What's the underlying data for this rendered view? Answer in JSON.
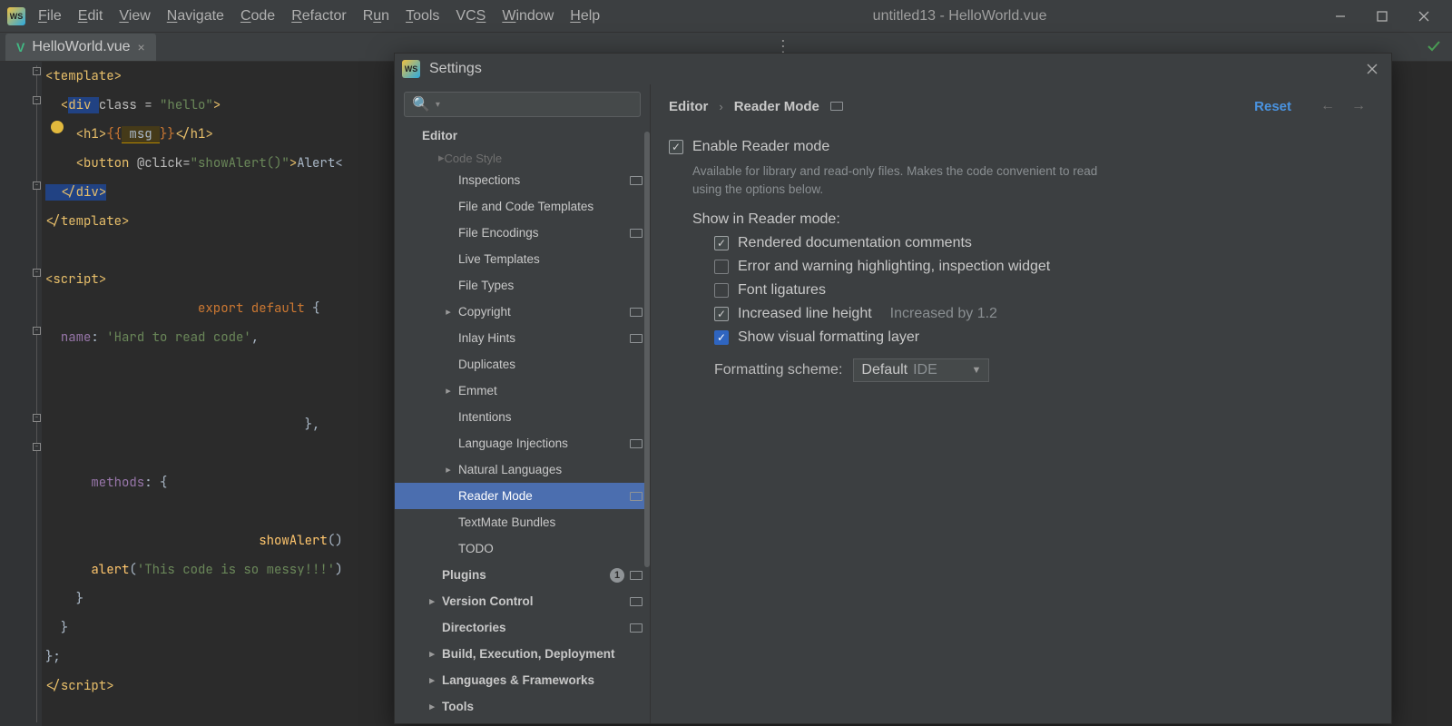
{
  "window": {
    "title": "untitled13 - HelloWorld.vue",
    "menus": [
      "File",
      "Edit",
      "View",
      "Navigate",
      "Code",
      "Refactor",
      "Run",
      "Tools",
      "VCS",
      "Window",
      "Help"
    ]
  },
  "tab": {
    "filename": "HelloWorld.vue"
  },
  "code": {
    "l1a": "<",
    "l1b": "template",
    "l1c": ">",
    "l2a": "  <",
    "l2b": "div ",
    "l2c": "class = ",
    "l2d": "\"hello\"",
    "l2e": ">",
    "l3a": "    <",
    "l3b": "h1",
    "l3c": ">",
    "l3d": "{{",
    "l3e": " msg ",
    "l3f": "}}",
    "l3g": "</",
    "l3h": "h1",
    "l3i": ">",
    "l4a": "    <",
    "l4b": "button ",
    "l4c": "@click=",
    "l4d": "\"showAlert()\"",
    "l4e": ">",
    "l4f": "Alert<",
    "l5a": "  </",
    "l5b": "div",
    "l5c": ">",
    "l6a": "</",
    "l6b": "template",
    "l6c": ">",
    "l7": "",
    "l8a": "<",
    "l8b": "script",
    "l8c": ">",
    "l9a": "                    ",
    "l9b": "export default ",
    "l9c": "{",
    "l10a": "  ",
    "l10b": "name",
    "l10c": ": ",
    "l10d": "'Hard to read code'",
    "l10e": ",",
    "l11": "",
    "l12": "",
    "l13a": "                                  ",
    "l13b": "}",
    "l13c": ",",
    "l14": "",
    "l15a": "      ",
    "l15b": "methods",
    "l15c": ": {",
    "l16": "",
    "l17a": "                            ",
    "l17b": "showAlert",
    "l17c": "()",
    "l18a": "      ",
    "l18b": "alert",
    "l18c": "(",
    "l18d": "'This code is so messy!!!'",
    "l18e": ")",
    "l19": "    }",
    "l20": "  }",
    "l21a": "}",
    "l21b": ";",
    "l22a": "</",
    "l22b": "script",
    "l22c": ">"
  },
  "settings": {
    "title": "Settings",
    "search_placeholder": "",
    "crumbs": {
      "root": "Editor",
      "leaf": "Reader Mode"
    },
    "reset": "Reset",
    "tree": {
      "faded": "Code Style",
      "editor": "Editor",
      "items": [
        {
          "label": "Inspections",
          "badge": true
        },
        {
          "label": "File and Code Templates"
        },
        {
          "label": "File Encodings",
          "badge": true
        },
        {
          "label": "Live Templates"
        },
        {
          "label": "File Types"
        },
        {
          "label": "Copyright",
          "chev": true,
          "badge": true
        },
        {
          "label": "Inlay Hints",
          "badge": true
        },
        {
          "label": "Duplicates"
        },
        {
          "label": "Emmet",
          "chev": true
        },
        {
          "label": "Intentions"
        },
        {
          "label": "Language Injections",
          "badge": true
        },
        {
          "label": "Natural Languages",
          "chev": true
        },
        {
          "label": "Reader Mode",
          "badge": true,
          "selected": true
        },
        {
          "label": "TextMate Bundles"
        },
        {
          "label": "TODO"
        }
      ],
      "below": [
        {
          "label": "Plugins",
          "count": "1",
          "badge": true
        },
        {
          "label": "Version Control",
          "chev": true,
          "badge": true
        },
        {
          "label": "Directories",
          "badge": true
        },
        {
          "label": "Build, Execution, Deployment",
          "chev": true
        },
        {
          "label": "Languages & Frameworks",
          "chev": true
        },
        {
          "label": "Tools",
          "chev": true
        }
      ]
    },
    "panel": {
      "enable": "Enable Reader mode",
      "help": "Available for library and read-only files. Makes the code convenient to read using the options below.",
      "show_label": "Show in Reader mode:",
      "opts": {
        "rendered": "Rendered documentation comments",
        "errors": "Error and warning highlighting, inspection widget",
        "ligatures": "Font ligatures",
        "lineheight": "Increased line height",
        "lineheight_hint": "Increased by 1.2",
        "visual": "Show visual formatting layer"
      },
      "scheme_label": "Formatting scheme:",
      "scheme_value": "Default",
      "scheme_hint": "IDE"
    }
  }
}
